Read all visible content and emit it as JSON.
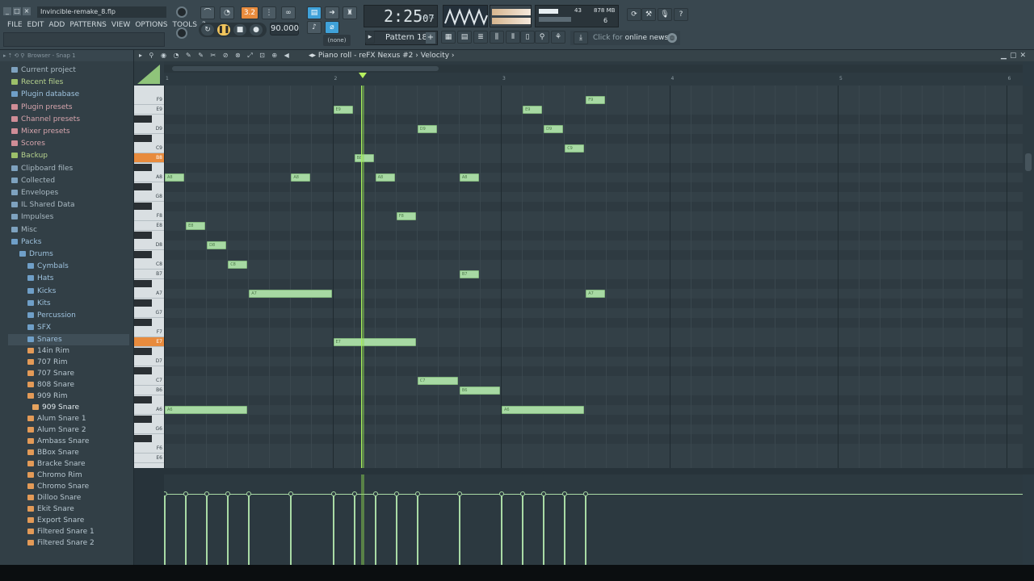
{
  "window": {
    "project_title": "Invincible-remake_8.flp",
    "controls": [
      "_",
      "□",
      "×"
    ]
  },
  "menu": [
    "FILE",
    "EDIT",
    "ADD",
    "PATTERNS",
    "VIEW",
    "OPTIONS",
    "TOOLS",
    "?"
  ],
  "transport": {
    "tempo": "90.000",
    "time_main": "2:25",
    "time_ms": "07",
    "time_unit": "M:S:CS",
    "pattern": "Pattern 18",
    "pattern_add": "+",
    "none_label": "(none)",
    "mode_toggle": "3.2"
  },
  "monitor": {
    "cpu_value": "43",
    "ram_value": "878 MB",
    "poly_value": "6"
  },
  "news": {
    "prefix": "Click for",
    "label": "online news"
  },
  "browser": {
    "header": "Browser - Snap 1",
    "items": [
      {
        "label": "Current project",
        "style": "folder"
      },
      {
        "label": "Recent files",
        "style": "green"
      },
      {
        "label": "Plugin database",
        "style": "blue"
      },
      {
        "label": "Plugin presets",
        "style": "pink"
      },
      {
        "label": "Channel presets",
        "style": "pink"
      },
      {
        "label": "Mixer presets",
        "style": "pink"
      },
      {
        "label": "Scores",
        "style": "pink"
      },
      {
        "label": "Backup",
        "style": "green"
      },
      {
        "label": "Clipboard files",
        "style": "folder"
      },
      {
        "label": "Collected",
        "style": "folder"
      },
      {
        "label": "Envelopes",
        "style": "folder"
      },
      {
        "label": "IL Shared Data",
        "style": "folder"
      },
      {
        "label": "Impulses",
        "style": "folder"
      },
      {
        "label": "Misc",
        "style": "folder"
      },
      {
        "label": "Packs",
        "style": "blue"
      },
      {
        "label": "Drums",
        "style": "blue"
      },
      {
        "label": "Cymbals",
        "style": "blue"
      },
      {
        "label": "Hats",
        "style": "blue"
      },
      {
        "label": "Kicks",
        "style": "blue"
      },
      {
        "label": "Kits",
        "style": "blue"
      },
      {
        "label": "Percussion",
        "style": "blue"
      },
      {
        "label": "SFX",
        "style": "blue"
      },
      {
        "label": "Snares",
        "style": "blue"
      },
      {
        "label": "14in Rim",
        "style": "orange"
      },
      {
        "label": "707 Rim",
        "style": "orange"
      },
      {
        "label": "707 Snare",
        "style": "orange"
      },
      {
        "label": "808 Snare",
        "style": "orange"
      },
      {
        "label": "909 Rim",
        "style": "orange"
      },
      {
        "label": "909 Snare",
        "style": "orange2"
      },
      {
        "label": "Alum Snare 1",
        "style": "orange"
      },
      {
        "label": "Alum Snare 2",
        "style": "orange"
      },
      {
        "label": "Ambass Snare",
        "style": "orange"
      },
      {
        "label": "BBox Snare",
        "style": "orange"
      },
      {
        "label": "Bracke Snare",
        "style": "orange"
      },
      {
        "label": "Chromo Rim",
        "style": "orange"
      },
      {
        "label": "Chromo Snare",
        "style": "orange"
      },
      {
        "label": "Dilloo Snare",
        "style": "orange"
      },
      {
        "label": "Ekit Snare",
        "style": "orange"
      },
      {
        "label": "Export Snare",
        "style": "orange"
      },
      {
        "label": "Filtered Snare 1",
        "style": "orange"
      },
      {
        "label": "Filtered Snare 2",
        "style": "orange"
      }
    ]
  },
  "piano_roll": {
    "title": "Piano roll - reFX Nexus #2",
    "target": "Velocity",
    "bar_numbers": [
      "1",
      "2",
      "3",
      "4",
      "5",
      "6"
    ],
    "keys": [
      "F9",
      "E9",
      "D#9",
      "D9",
      "C#9",
      "C9",
      "B8",
      "A#8",
      "A8",
      "G#8",
      "G8",
      "F#8",
      "F8",
      "E8",
      "D#8",
      "D8",
      "C#8",
      "C8",
      "B7",
      "A#7",
      "A7",
      "G#7",
      "G7",
      "F#7",
      "F7",
      "E7",
      "D#7",
      "D7",
      "C#7",
      "C7",
      "B6",
      "A#6",
      "A6",
      "G#6",
      "G6",
      "F#6",
      "F6",
      "E6"
    ],
    "key_labels": {
      "F9": "F9",
      "E9": "E9",
      "D9": "D9",
      "C9": "C9",
      "B8": "B8",
      "A8": "A8",
      "G8": "G8",
      "F8": "F8",
      "E8": "E8",
      "D8": "D8",
      "C8": "C8",
      "B7": "B7",
      "A7": "A7",
      "G7": "G7",
      "F7": "F7",
      "E7": "E7",
      "D7": "D7",
      "C7": "C7",
      "B6": "B6",
      "A6": "A6",
      "G6": "G6",
      "F6": "F6",
      "E6": "E6"
    },
    "highlighted_keys": [
      "B8",
      "E7"
    ],
    "steps_per_bar": 8,
    "notes": [
      {
        "pitch": "A8",
        "start": 0,
        "length": 1,
        "label": "A8"
      },
      {
        "pitch": "E8",
        "start": 1,
        "length": 1,
        "label": "E8"
      },
      {
        "pitch": "D8",
        "start": 2,
        "length": 1,
        "label": "D8"
      },
      {
        "pitch": "C8",
        "start": 3,
        "length": 1,
        "label": "C8"
      },
      {
        "pitch": "A7",
        "start": 4,
        "length": 4,
        "label": "A7"
      },
      {
        "pitch": "A8",
        "start": 6,
        "length": 1,
        "label": "A8"
      },
      {
        "pitch": "A6",
        "start": 0,
        "length": 4,
        "label": "A6"
      },
      {
        "pitch": "E9",
        "start": 8,
        "length": 1,
        "label": "E9"
      },
      {
        "pitch": "B8",
        "start": 9,
        "length": 1,
        "label": "B8"
      },
      {
        "pitch": "A8",
        "start": 10,
        "length": 1,
        "label": "A8"
      },
      {
        "pitch": "F8",
        "start": 11,
        "length": 1,
        "label": "F8"
      },
      {
        "pitch": "E7",
        "start": 8,
        "length": 4,
        "label": "E7"
      },
      {
        "pitch": "D9",
        "start": 12,
        "length": 1,
        "label": "D9"
      },
      {
        "pitch": "A8",
        "start": 14,
        "length": 1,
        "label": "A8"
      },
      {
        "pitch": "B7",
        "start": 14,
        "length": 1,
        "label": "B7"
      },
      {
        "pitch": "C7",
        "start": 12,
        "length": 2,
        "label": "C7"
      },
      {
        "pitch": "B6",
        "start": 14,
        "length": 2,
        "label": "B6"
      },
      {
        "pitch": "A6",
        "start": 16,
        "length": 4,
        "label": "A6"
      },
      {
        "pitch": "E9",
        "start": 17,
        "length": 1,
        "label": "E9"
      },
      {
        "pitch": "D9",
        "start": 18,
        "length": 1,
        "label": "D9"
      },
      {
        "pitch": "C9",
        "start": 19,
        "length": 1,
        "label": "C9"
      },
      {
        "pitch": "F9",
        "start": 20,
        "length": 1,
        "label": "F9"
      },
      {
        "pitch": "A7",
        "start": 20,
        "length": 1,
        "label": "A7"
      }
    ],
    "playhead_step": 9.35
  },
  "colors": {
    "note_fill": "#a7d9a3",
    "accent_orange": "#e88b3d",
    "playhead": "#a7ec5d"
  }
}
